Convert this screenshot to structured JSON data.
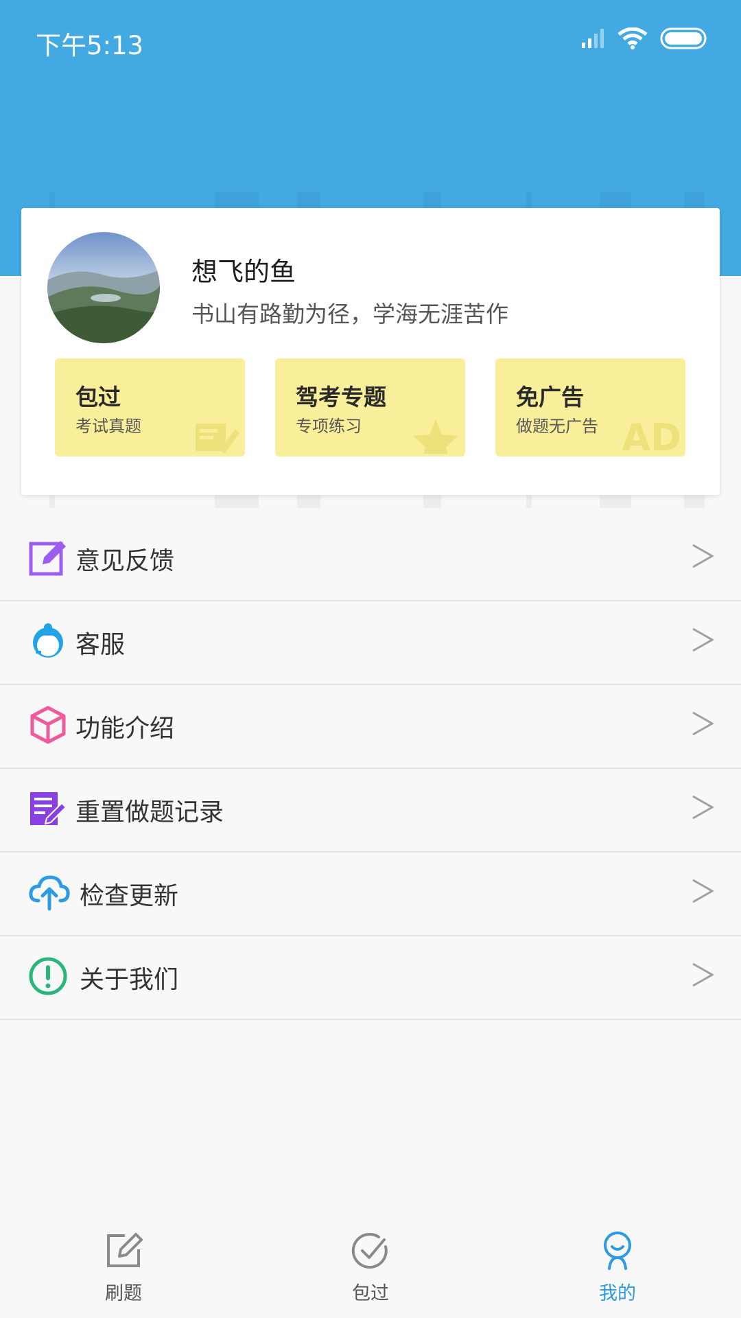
{
  "status_bar": {
    "time": "下午5:13"
  },
  "profile": {
    "name": "想飞的鱼",
    "motto": "书山有路勤为径，学海无涯苦作"
  },
  "features": [
    {
      "title": "包过",
      "subtitle": "考试真题",
      "icon": "edit-deco-icon"
    },
    {
      "title": "驾考专题",
      "subtitle": "专项练习",
      "icon": "star-deco-icon"
    },
    {
      "title": "免广告",
      "subtitle": "做题无广告",
      "icon": "ad-deco-icon",
      "deco_text": "AD"
    }
  ],
  "menu": {
    "items": [
      {
        "label": "意见反馈",
        "icon": "feedback-edit-icon",
        "color": "#9c5ef0"
      },
      {
        "label": "客服",
        "icon": "customer-service-icon",
        "color": "#22a3e8"
      },
      {
        "label": "功能介绍",
        "icon": "cube-icon",
        "color": "#ef5a9c"
      },
      {
        "label": "重置做题记录",
        "icon": "reset-record-icon",
        "color": "#8a3fe0"
      },
      {
        "label": "检查更新",
        "icon": "cloud-upload-icon",
        "color": "#2d9be3"
      },
      {
        "label": "关于我们",
        "icon": "info-exclamation-icon",
        "color": "#28b67a"
      }
    ],
    "arrow": ">"
  },
  "tabbar": {
    "tabs": [
      {
        "label": "刷题",
        "icon": "edit-icon",
        "active": false
      },
      {
        "label": "包过",
        "icon": "check-circle-icon",
        "active": false
      },
      {
        "label": "我的",
        "icon": "person-icon",
        "active": true
      }
    ]
  },
  "colors": {
    "header": "#42a9e3",
    "accent": "#2d9be3",
    "feature_bg": "#f9ef9b"
  }
}
